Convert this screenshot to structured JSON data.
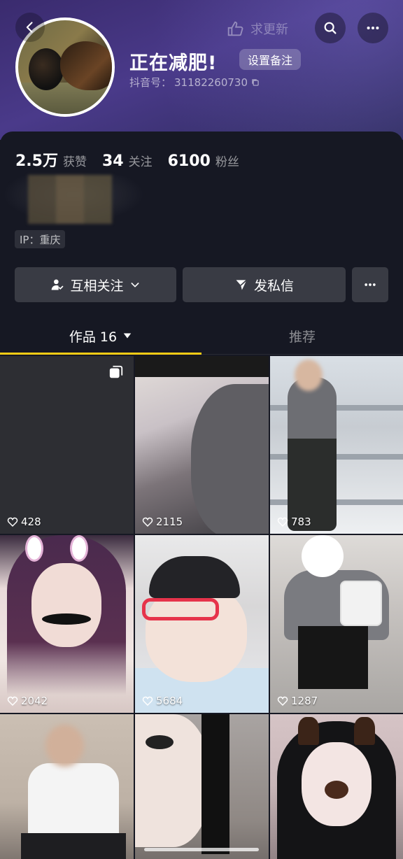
{
  "header": {
    "request_update_label": "求更新",
    "nickname": "正在减肥!",
    "remark_label": "设置备注",
    "douyin_id_label": "抖音号：",
    "douyin_id": "31182260730"
  },
  "stats": [
    {
      "value": "2.5万",
      "label": "获赞"
    },
    {
      "value": "34",
      "label": "关注"
    },
    {
      "value": "6100",
      "label": "粉丝"
    }
  ],
  "ip_location": "IP：重庆",
  "actions": {
    "follow_label": "互相关注",
    "message_label": "发私信"
  },
  "tabs": [
    {
      "label": "作品 16",
      "active": true
    },
    {
      "label": "推荐",
      "active": false
    }
  ],
  "videos": [
    {
      "likes": "428",
      "multi_image": true
    },
    {
      "likes": "2115"
    },
    {
      "likes": "783"
    },
    {
      "likes": "2042"
    },
    {
      "likes": "5684"
    },
    {
      "likes": "1287"
    },
    {
      "likes": ""
    },
    {
      "likes": ""
    },
    {
      "likes": ""
    }
  ],
  "colors": {
    "background": "#161823",
    "tab_indicator": "#facc15",
    "button_bg": "#393b44"
  },
  "icons": [
    "back-icon",
    "thumb-icon",
    "search-icon",
    "more-icon",
    "copy-icon",
    "user-check-icon",
    "chevron-down-icon",
    "send-icon",
    "heart-icon",
    "multi-image-icon"
  ]
}
